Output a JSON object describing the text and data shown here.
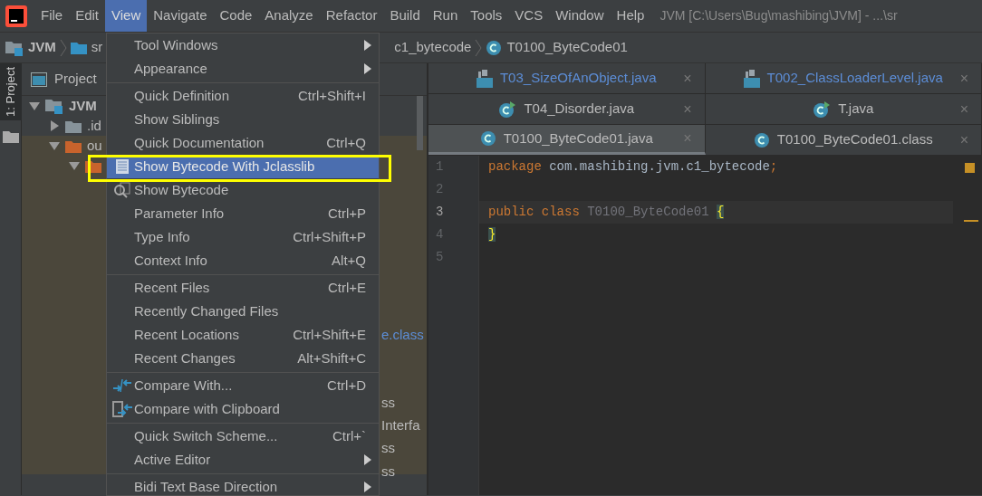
{
  "window": {
    "title": "JVM [C:\\Users\\Bug\\mashibing\\JVM] - ...\\sr"
  },
  "menubar": [
    {
      "label": "File",
      "selected": false
    },
    {
      "label": "Edit",
      "selected": false
    },
    {
      "label": "View",
      "selected": true
    },
    {
      "label": "Navigate",
      "selected": false
    },
    {
      "label": "Code",
      "selected": false
    },
    {
      "label": "Analyze",
      "selected": false
    },
    {
      "label": "Refactor",
      "selected": false
    },
    {
      "label": "Build",
      "selected": false
    },
    {
      "label": "Run",
      "selected": false
    },
    {
      "label": "Tools",
      "selected": false
    },
    {
      "label": "VCS",
      "selected": false
    },
    {
      "label": "Window",
      "selected": false
    },
    {
      "label": "Help",
      "selected": false
    }
  ],
  "breadcrumb": [
    {
      "label": "JVM",
      "kind": "module"
    },
    {
      "label": "sr",
      "kind": "folder"
    },
    {
      "label": "c1_bytecode",
      "kind": "package"
    },
    {
      "label": "T0100_ByteCode01",
      "kind": "class"
    }
  ],
  "side_strip": {
    "label": "1: Project"
  },
  "project_panel": {
    "title": "Project",
    "tree": [
      {
        "label": "JVM",
        "kind": "module",
        "expanded": true,
        "children": [
          {
            "label": ".id",
            "kind": "folder",
            "expanded": false
          },
          {
            "label": "ou",
            "kind": "excluded",
            "expanded": true,
            "children": [
              {
                "kind": "excluded",
                "expanded": true
              }
            ]
          }
        ]
      }
    ],
    "fragments": [
      {
        "label": "e.class",
        "kind": "link"
      },
      {
        "label": "ss",
        "kind": "plain"
      },
      {
        "label": "Interfa",
        "kind": "plain"
      },
      {
        "label": "ss",
        "kind": "plain"
      },
      {
        "label": "ss",
        "kind": "plain"
      }
    ]
  },
  "tab_rows": [
    [
      {
        "label": "T03_SizeOfAnObject.java",
        "kind": "file",
        "selected": false,
        "close": "×"
      },
      {
        "label": "T002_ClassLoaderLevel.java",
        "kind": "file",
        "selected": false,
        "close": "×"
      }
    ],
    [
      {
        "label": "T04_Disorder.java",
        "kind": "runnable",
        "selected": false,
        "close": "×"
      },
      {
        "label": "T.java",
        "kind": "runnable",
        "selected": false,
        "close": "×"
      }
    ],
    [
      {
        "label": "T0100_ByteCode01.java",
        "kind": "class",
        "selected": true,
        "close": "×"
      },
      {
        "label": "T0100_ByteCode01.class",
        "kind": "class",
        "selected": false,
        "close": "×"
      }
    ]
  ],
  "editor": {
    "lines": [
      {
        "number": "1",
        "current": false,
        "tokens": [
          {
            "text": "package ",
            "kind": "keyword"
          },
          {
            "text": "com.mashibing.jvm.c1_bytecode",
            "kind": "plain"
          },
          {
            "text": ";",
            "kind": "keyword"
          }
        ]
      },
      {
        "number": "2",
        "current": false
      },
      {
        "number": "3",
        "current": true,
        "tokens": [
          {
            "text": "public class ",
            "kind": "keyword"
          },
          {
            "text": "T0100_ByteCode01 ",
            "kind": "unused"
          },
          {
            "text": "{",
            "kind": "brace"
          }
        ]
      },
      {
        "number": "4",
        "current": false,
        "tokens": [
          {
            "text": "}",
            "kind": "brace"
          }
        ]
      },
      {
        "number": "5",
        "current": false
      }
    ]
  },
  "view_menu": [
    {
      "kind": "plain",
      "label": "Tool Windows",
      "submenu": true,
      "selected": false
    },
    {
      "kind": "plain",
      "label": "Appearance",
      "submenu": true,
      "selected": false
    },
    {
      "kind": "separator"
    },
    {
      "kind": "plain",
      "label": "Quick Definition",
      "shortcut": "Ctrl+Shift+I",
      "submenu": false,
      "selected": false
    },
    {
      "kind": "plain",
      "label": "Show Siblings",
      "submenu": false,
      "selected": false
    },
    {
      "kind": "plain",
      "label": "Quick Documentation",
      "shortcut": "Ctrl+Q",
      "submenu": false,
      "selected": false
    },
    {
      "kind": "jclasslib",
      "label": "Show Bytecode With Jclasslib",
      "submenu": false,
      "selected": true
    },
    {
      "kind": "bytecode",
      "label": "Show Bytecode",
      "submenu": false,
      "selected": false
    },
    {
      "kind": "plain",
      "label": "Parameter Info",
      "shortcut": "Ctrl+P",
      "submenu": false,
      "selected": false
    },
    {
      "kind": "plain",
      "label": "Type Info",
      "shortcut": "Ctrl+Shift+P",
      "submenu": false,
      "selected": false
    },
    {
      "kind": "plain",
      "label": "Context Info",
      "shortcut": "Alt+Q",
      "submenu": false,
      "selected": false
    },
    {
      "kind": "separator"
    },
    {
      "kind": "plain",
      "label": "Recent Files",
      "shortcut": "Ctrl+E",
      "submenu": false,
      "selected": false
    },
    {
      "kind": "plain",
      "label": "Recently Changed Files",
      "submenu": false,
      "selected": false
    },
    {
      "kind": "plain",
      "label": "Recent Locations",
      "shortcut": "Ctrl+Shift+E",
      "submenu": false,
      "selected": false
    },
    {
      "kind": "plain",
      "label": "Recent Changes",
      "shortcut": "Alt+Shift+C",
      "submenu": false,
      "selected": false
    },
    {
      "kind": "separator"
    },
    {
      "kind": "compare",
      "label": "Compare With...",
      "shortcut": "Ctrl+D",
      "submenu": false,
      "selected": false
    },
    {
      "kind": "clipboard",
      "label": "Compare with Clipboard",
      "submenu": false,
      "selected": false
    },
    {
      "kind": "separator"
    },
    {
      "kind": "plain",
      "label": "Quick Switch Scheme...",
      "shortcut": "Ctrl+`",
      "submenu": false,
      "selected": false
    },
    {
      "kind": "plain",
      "label": "Active Editor",
      "submenu": true,
      "selected": false
    },
    {
      "kind": "separator"
    },
    {
      "kind": "plain",
      "label": "Bidi Text Base Direction",
      "submenu": true,
      "selected": false
    }
  ]
}
